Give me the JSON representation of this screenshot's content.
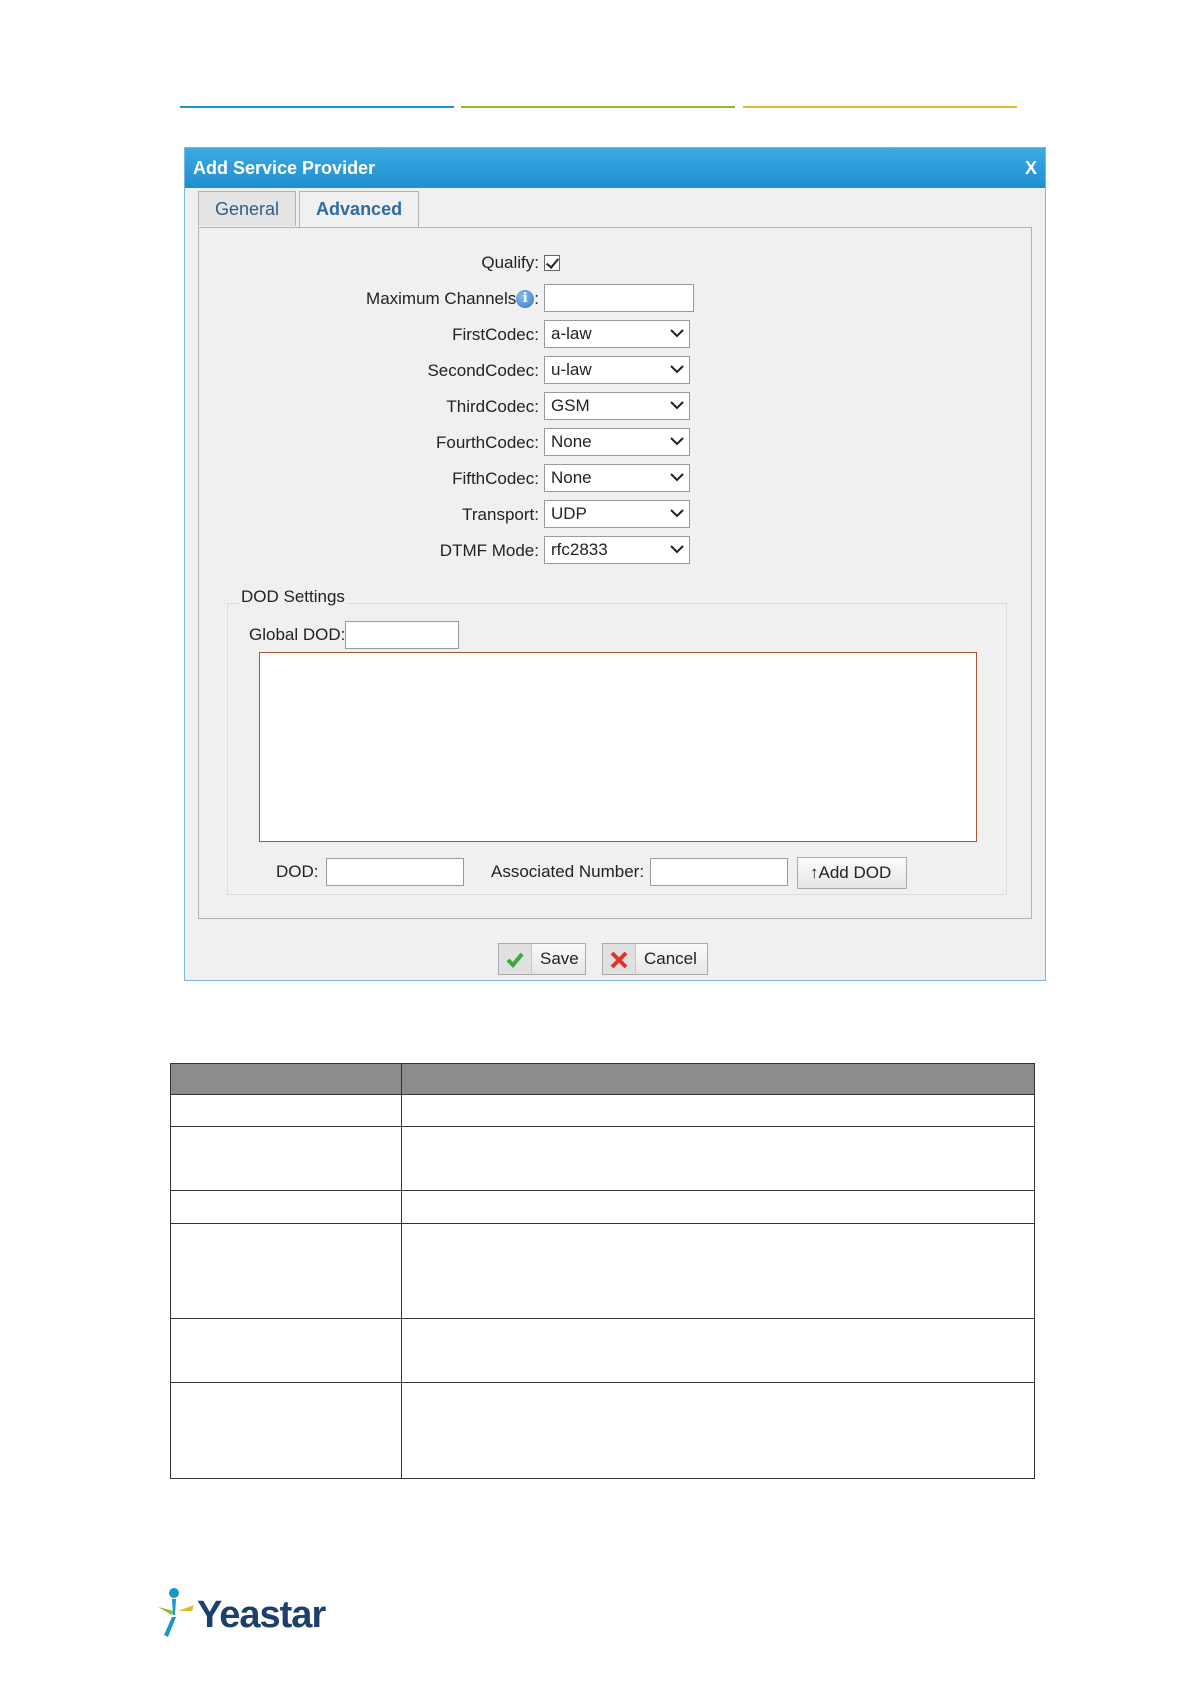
{
  "dialog": {
    "title": "Add Service Provider",
    "close_label": "X",
    "tabs": [
      {
        "label": "General",
        "active": false
      },
      {
        "label": "Advanced",
        "active": true
      }
    ]
  },
  "form": {
    "qualify_label": "Qualify",
    "qualify_checked": true,
    "max_channels_label": "Maximum Channels",
    "max_channels_value": "",
    "first_codec_label": "FirstCodec",
    "first_codec_value": "a-law",
    "second_codec_label": "SecondCodec",
    "second_codec_value": "u-law",
    "third_codec_label": "ThirdCodec",
    "third_codec_value": "GSM",
    "fourth_codec_label": "FourthCodec",
    "fourth_codec_value": "None",
    "fifth_codec_label": "FifthCodec",
    "fifth_codec_value": "None",
    "transport_label": "Transport",
    "transport_value": "UDP",
    "dtmf_label": "DTMF Mode",
    "dtmf_value": "rfc2833"
  },
  "dod": {
    "legend": "DOD Settings",
    "global_label": "Global DOD:",
    "dod_label": "DOD:",
    "associated_label": "Associated Number:",
    "add_button": "↑Add DOD"
  },
  "footer": {
    "save_label": "Save",
    "cancel_label": "Cancel"
  },
  "brand": {
    "name": "Yeastar"
  }
}
